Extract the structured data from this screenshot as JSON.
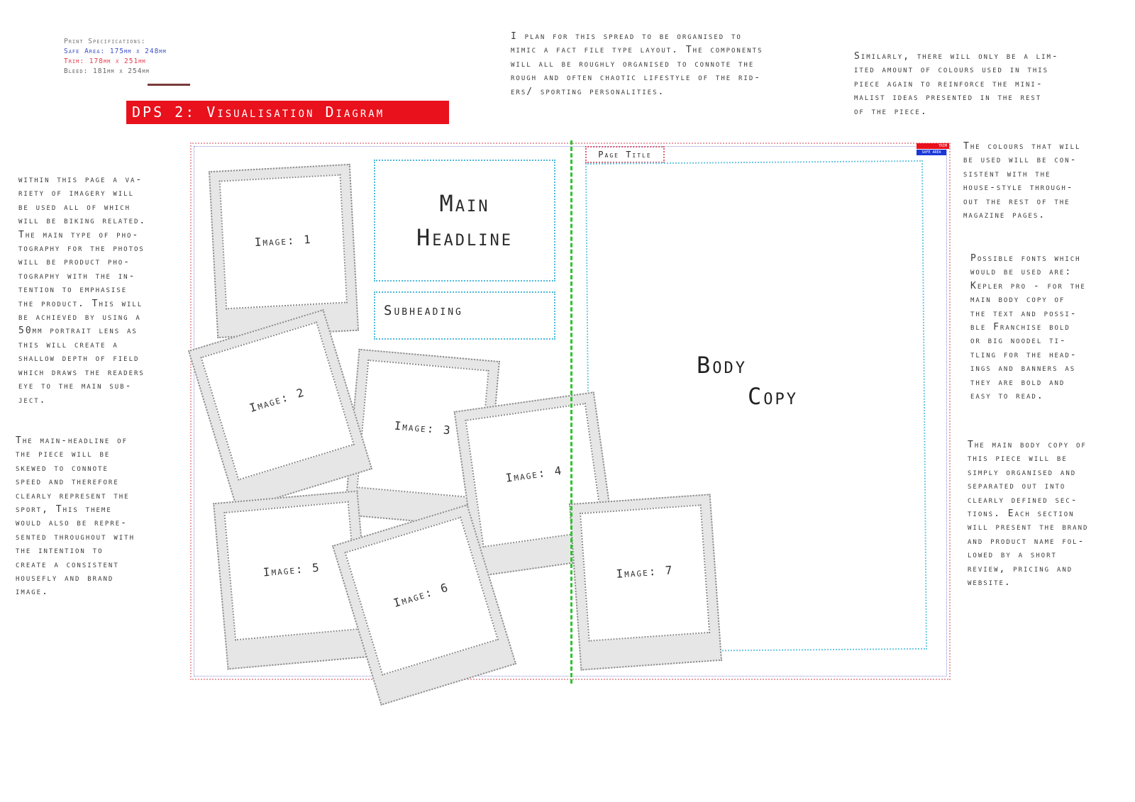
{
  "specs": {
    "heading": "Print Specifications:",
    "safe": "Safe Area: 175mm x 248mm",
    "trim": "Trim:  178mm x 251mm",
    "bleed": "Bleed: 181mm x 254mm"
  },
  "banner": "DPS 2: Visualisation Diagram",
  "notes": {
    "layout": "I plan for this spread to be organised to\nmimic a fact file type layout. The components\nwill all be roughly organised to connote the\nrough and often chaotic lifestyle of the rid-\ners/ sporting personalities.",
    "colours_limited": "Similarly, there will only be a lim-\nited amount of colours used in this\npiece again to reinforce the mini-\nmalist ideas presented in the rest\nof the piece.",
    "imagery": "within this page a va-\nriety of imagery will\nbe used all of which\nwill be biking related.\nThe main type of pho-\ntography for the photos\nwill be product pho-\ntography with the in-\ntention to emphasise\nthe product. This will\nbe achieved by using a\n50mm portrait lens as\nthis will create a\nshallow depth of field\nwhich draws the readers\neye to the main sub-\nject.",
    "headline": "The main-headline of\nthe piece will be\nskewed to connote\nspeed and therefore\nclearly represent the\nsport, This theme\nwould also be repre-\nsented throughout with\nthe intention to\ncreate a consistent\nhousefly and brand\nimage.",
    "colours_house": "The colours that will\nbe used will be con-\nsistent with the\nhouse-style through-\nout the rest of the\nmagazine pages.",
    "fonts": "Possible fonts which\nwould be used are:\nKepler pro - for the\nmain body copy of\nthe text and possi-\nble Franchise bold\nor big noodel ti-\ntling for the head-\nings and banners as\nthey are bold and\neasy to read.",
    "body": "The main body copy of\nthis piece will be\nsimply organised and\nseparated out into\nclearly defined sec-\ntions. Each section\nwill present the brand\nand product name fol-\nlowed by a short\nreview, pricing and\nwebsite."
  },
  "spread": {
    "headline_line1": "Main",
    "headline_line2": "Headline",
    "subheading": "Subheading",
    "page_title": "Page Title",
    "body_line1": "Body",
    "body_line2": "Copy",
    "badge_red": "TRIM",
    "badge_blue": "SAFE AREA",
    "images": [
      "Image: 1",
      "Image: 2",
      "Image: 3",
      "Image: 4",
      "Image: 5",
      "Image: 6",
      "Image: 7"
    ]
  },
  "colors": {
    "banner": "#e8111c",
    "safe_area": "#3b4fc8",
    "trim": "#e8384a",
    "gutter": "#2ec42e",
    "text_box": "#4fb8d8"
  }
}
